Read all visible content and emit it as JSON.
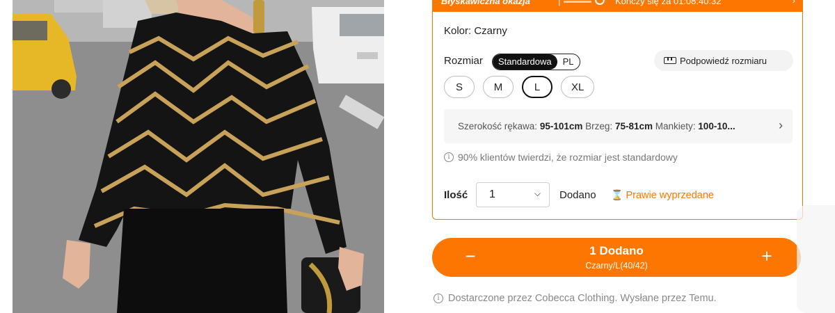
{
  "flash_sale": {
    "title": "Błyskawiczna okazja",
    "separator": "|",
    "timer": "Kończy się za 01:08:40:32",
    "chevron": "›"
  },
  "product": {
    "color_label": "Kolor: Czarny",
    "size_label": "Rozmiar",
    "size_systems": [
      "Standardowa",
      "PL"
    ],
    "size_system_selected": "Standardowa",
    "size_hint": "Podpowiedź rozmiaru",
    "sizes": [
      "S",
      "M",
      "L",
      "XL"
    ],
    "selected_size": "L",
    "measurements": {
      "sleeve_label": "Szerokość rękawa:",
      "sleeve_value": "95-101cm",
      "hem_label": "Brzeg:",
      "hem_value": "75-81cm",
      "cuffs_label": "Mankiety:",
      "cuffs_value": "100-10...",
      "chevron": "›"
    },
    "fit_note": "90% klientów twierdzi, że rozmiar jest standardowy",
    "quantity": {
      "label": "Ilość",
      "value": "1",
      "added_label": "Dodano",
      "almost_sold": "Prawie wyprzedane"
    }
  },
  "cart": {
    "title": "1 Dodano",
    "subtitle": "Czarny/L(40/42)",
    "minus": "−",
    "plus": "+"
  },
  "supplier_note": "Dostarczone przez Cobecca Clothing. Wysłane przez Temu.",
  "colors": {
    "accent": "#fb7701",
    "garment": "#141414",
    "stripe_gold": "#c9a25a"
  },
  "icons": {
    "clock": "clock-icon",
    "ruler": "ruler-icon",
    "info": "info-icon",
    "hourglass": "hourglass-icon",
    "chevron": "chevron-down-icon"
  }
}
